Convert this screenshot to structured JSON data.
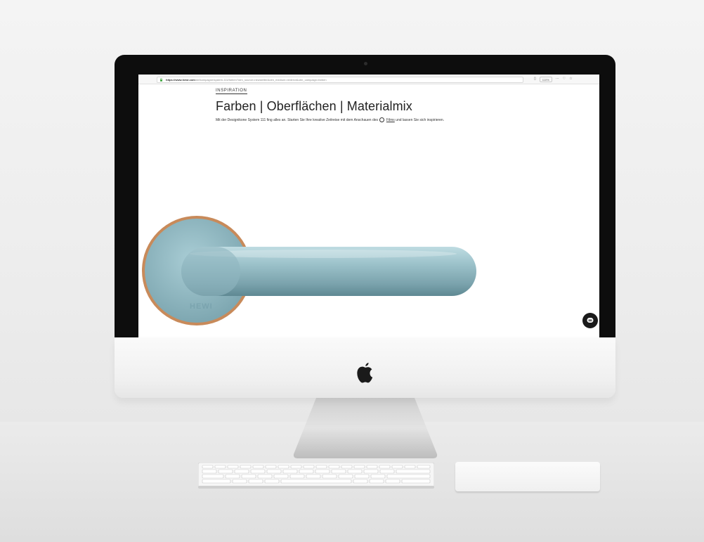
{
  "browser": {
    "url_host": "https://www.hewi.com",
    "url_rest": "/de/kampagne/system-111/farben?utm_source=newsletter&utm_medium=redirect&utm_campaign=farben",
    "zoom": "110%"
  },
  "page": {
    "eyebrow": "INSPIRATION",
    "title": "Farben | Oberflächen | Materialmix",
    "intro_before": "Mit der Designikone System 111 fing alles an. Starten Sie Ihre kreative Zeitreise mit dem Anschauen des",
    "film_link": "Films",
    "intro_after": "und lassen Sie sich inspirieren.",
    "brand_mark": "HEWI"
  },
  "icons": {
    "apple": "apple-logo-icon",
    "chat": "chat-bubble-icon",
    "lock": "lock-icon",
    "play": "play-circle-icon"
  },
  "colors": {
    "handle": "#8fb6c0",
    "rosette_ring": "#c88a5a",
    "bezel": "#0d0d0d"
  }
}
